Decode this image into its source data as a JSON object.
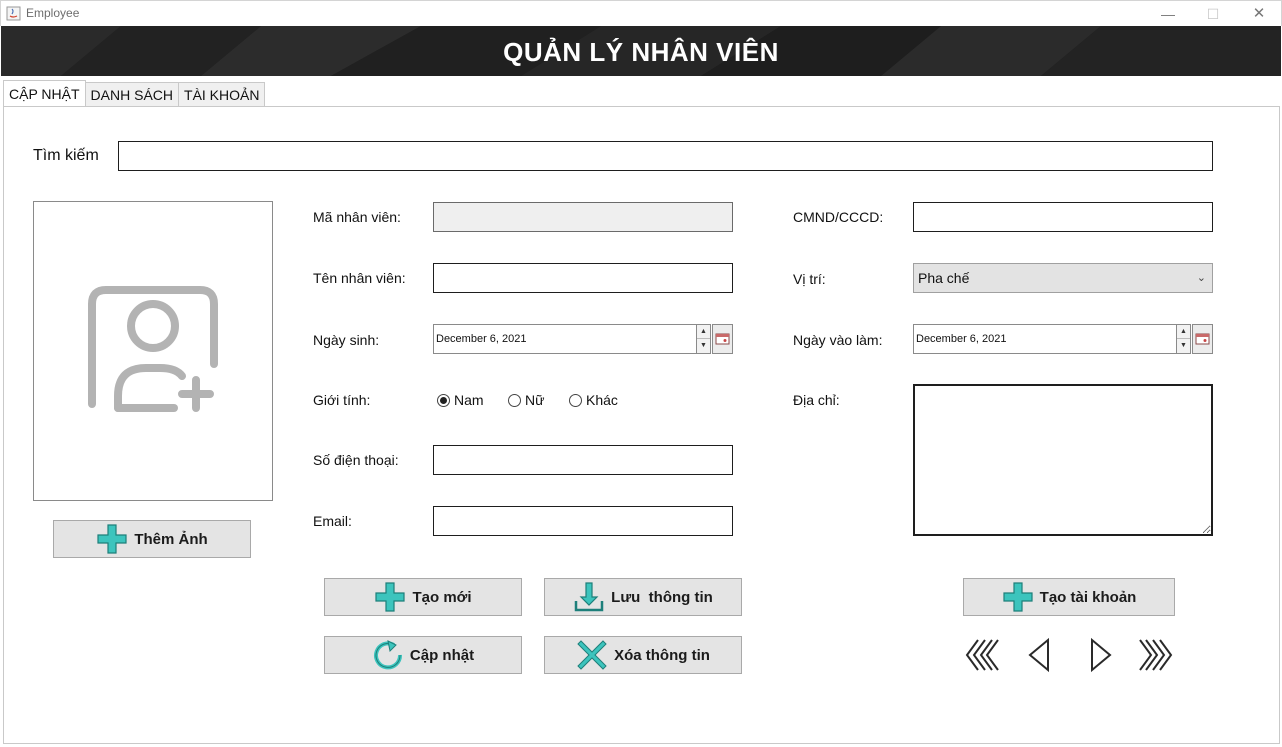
{
  "window": {
    "title": "Employee",
    "minimize": "—",
    "maximize": "☐",
    "close": "✕"
  },
  "header": {
    "title": "QUẢN LÝ NHÂN VIÊN"
  },
  "tabs": [
    {
      "label": "CẬP NHẬT",
      "active": true
    },
    {
      "label": "DANH SÁCH",
      "active": false
    },
    {
      "label": "TÀI KHOẢN",
      "active": false
    }
  ],
  "search": {
    "label": "Tìm kiếm",
    "value": ""
  },
  "photo": {
    "add_button": "Thêm Ảnh"
  },
  "form": {
    "employee_id": {
      "label": "Mã nhân viên:",
      "value": ""
    },
    "employee_name": {
      "label": "Tên nhân viên:",
      "value": ""
    },
    "birth_date": {
      "label": "Ngày sinh:",
      "value": "December 6, 2021"
    },
    "gender": {
      "label": "Giới tính:",
      "options": [
        {
          "label": "Nam",
          "selected": true
        },
        {
          "label": "Nữ",
          "selected": false
        },
        {
          "label": "Khác",
          "selected": false
        }
      ]
    },
    "phone": {
      "label": "Số điện thoại:",
      "value": ""
    },
    "email": {
      "label": "Email:",
      "value": ""
    },
    "id_card": {
      "label": "CMND/CCCD:",
      "value": ""
    },
    "position": {
      "label": "Vị trí:",
      "value": "Pha chế"
    },
    "start_date": {
      "label": "Ngày vào làm:",
      "value": "December 6, 2021"
    },
    "address": {
      "label": "Địa chỉ:",
      "value": ""
    }
  },
  "actions": {
    "create": "Tạo mới",
    "save": "Lưu  thông tin",
    "update": "Cập nhật",
    "delete": "Xóa thông tin",
    "create_account": "Tạo tài khoản"
  },
  "colors": {
    "accent_teal": "#3cc4bd",
    "banner_bg": "#1b1b1b",
    "button_bg": "#e4e4e4"
  }
}
